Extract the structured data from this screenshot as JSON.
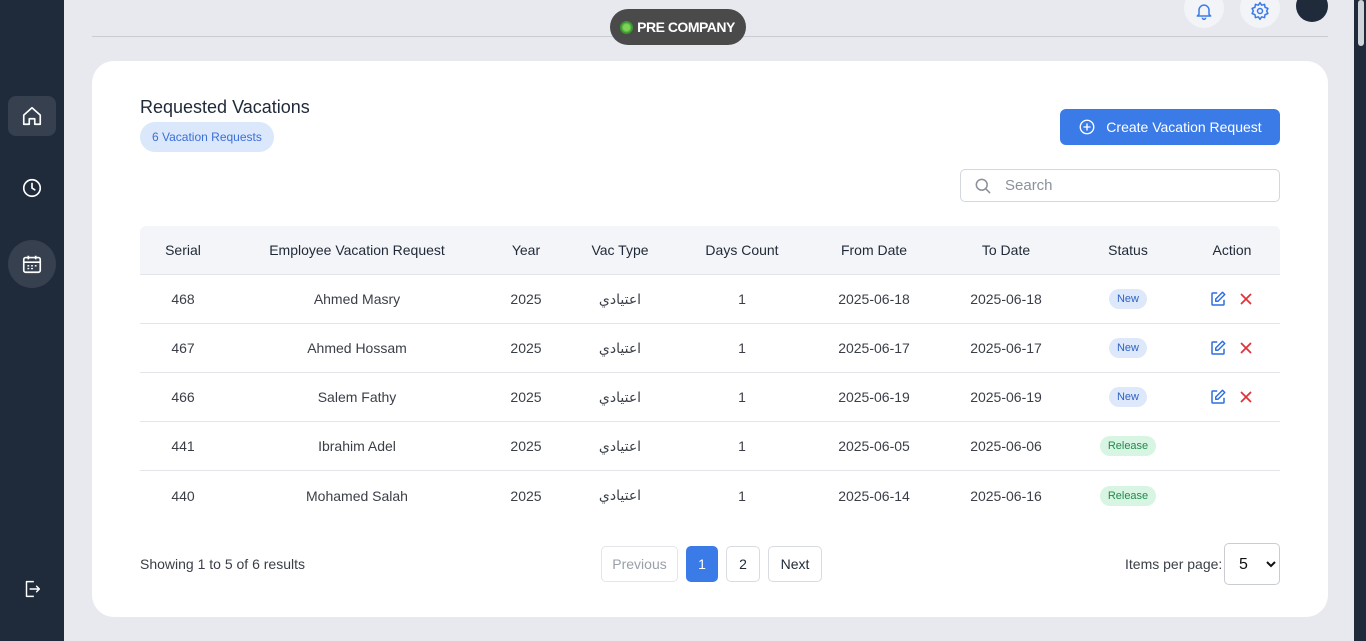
{
  "brand": {
    "name": "PRE COMPANY"
  },
  "page": {
    "title": "Requested Vacations",
    "count_badge": "6 Vacation Requests",
    "create_button": "Create Vacation Request",
    "search_placeholder": "Search"
  },
  "table": {
    "headers": [
      "Serial",
      "Employee Vacation Request",
      "Year",
      "Vac Type",
      "Days Count",
      "From Date",
      "To Date",
      "Status",
      "Action"
    ],
    "rows": [
      {
        "serial": "468",
        "employee": "Ahmed Masry",
        "year": "2025",
        "vac_type": "اعتيادي",
        "days": "1",
        "from": "2025-06-18",
        "to": "2025-06-18",
        "status": "New"
      },
      {
        "serial": "467",
        "employee": "Ahmed Hossam",
        "year": "2025",
        "vac_type": "اعتيادي",
        "days": "1",
        "from": "2025-06-17",
        "to": "2025-06-17",
        "status": "New"
      },
      {
        "serial": "466",
        "employee": "Salem Fathy",
        "year": "2025",
        "vac_type": "اعتيادي",
        "days": "1",
        "from": "2025-06-19",
        "to": "2025-06-19",
        "status": "New"
      },
      {
        "serial": "441",
        "employee": "Ibrahim Adel",
        "year": "2025",
        "vac_type": "اعتيادي",
        "days": "1",
        "from": "2025-06-05",
        "to": "2025-06-06",
        "status": "Release"
      },
      {
        "serial": "440",
        "employee": "Mohamed Salah",
        "year": "2025",
        "vac_type": "اعتيادي",
        "days": "1",
        "from": "2025-06-14",
        "to": "2025-06-16",
        "status": "Release"
      }
    ]
  },
  "footer": {
    "showing": "Showing 1 to 5 of 6 results",
    "previous": "Previous",
    "pages": [
      "1",
      "2"
    ],
    "next": "Next",
    "items_per_page_label": "Items per page:",
    "items_per_page_value": "5"
  },
  "colors": {
    "primary": "#3b7be8",
    "sidebar": "#1f2a3b",
    "new_badge": "#dde8fb",
    "release_badge": "#d8f4e2",
    "delete_icon": "#e0333a"
  },
  "icons": {
    "sidebar": [
      "home-icon",
      "clock-icon",
      "calendar-icon",
      "logout-icon"
    ],
    "header": [
      "bell-icon",
      "gear-icon"
    ],
    "row_actions": [
      "edit-icon",
      "close-icon"
    ]
  }
}
